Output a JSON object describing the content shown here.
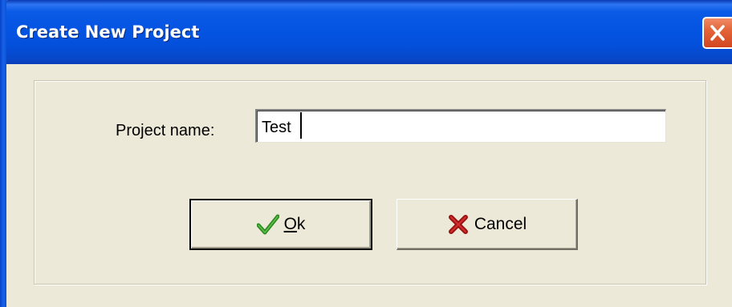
{
  "window": {
    "title": "Create New Project",
    "close_icon": "close-icon"
  },
  "form": {
    "project_name_label": "Project name:",
    "project_name_value": "Test"
  },
  "buttons": {
    "ok_accel": "O",
    "ok_rest": "k",
    "ok_icon": "checkmark-icon",
    "cancel_label": "Cancel",
    "cancel_icon": "x-mark-icon"
  },
  "colors": {
    "titlebar": "#0554E2",
    "close_button": "#E4643A",
    "dialog_background": "#ECE9D8",
    "ok_icon": "#2E8B22",
    "cancel_icon": "#9B1010"
  }
}
